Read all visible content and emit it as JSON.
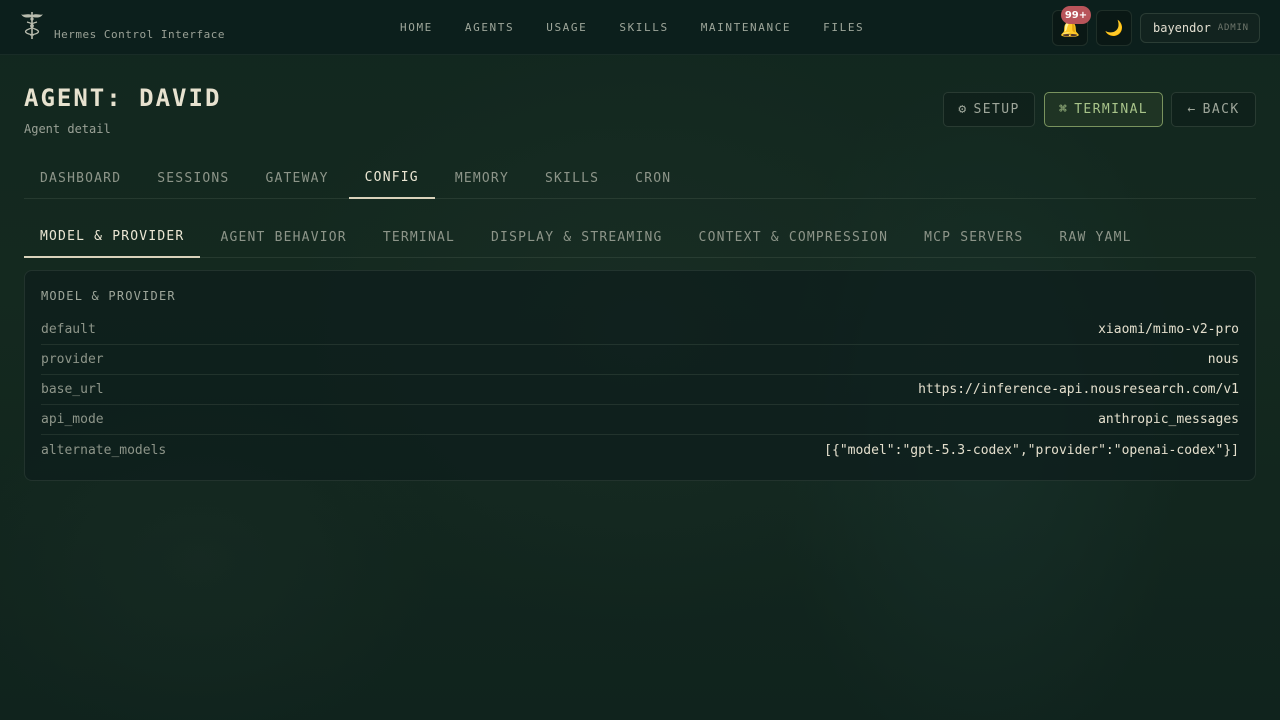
{
  "app": {
    "subtitle": "Hermes Control Interface"
  },
  "nav": [
    "HOME",
    "AGENTS",
    "USAGE",
    "SKILLS",
    "MAINTENANCE",
    "FILES"
  ],
  "header": {
    "notifications_badge": "99+",
    "notification_icon": "bell-icon",
    "theme_icon": "moon-icon",
    "user_name": "bayendor",
    "user_role": "ADMIN"
  },
  "page": {
    "title": "AGENT: DAVID",
    "subtitle": "Agent detail"
  },
  "actions": {
    "setup": {
      "icon": "⚙",
      "label": "SETUP"
    },
    "terminal": {
      "icon": "⌘",
      "label": "TERMINAL"
    },
    "back": {
      "icon": "←",
      "label": "BACK"
    }
  },
  "tabs": {
    "labels": [
      "DASHBOARD",
      "SESSIONS",
      "GATEWAY",
      "CONFIG",
      "MEMORY",
      "SKILLS",
      "CRON"
    ],
    "active": "CONFIG"
  },
  "subtabs": {
    "labels": [
      "MODEL & PROVIDER",
      "AGENT BEHAVIOR",
      "TERMINAL",
      "DISPLAY & STREAMING",
      "CONTEXT & COMPRESSION",
      "MCP SERVERS",
      "RAW YAML"
    ],
    "active": "MODEL & PROVIDER"
  },
  "panel": {
    "title": "MODEL & PROVIDER",
    "rows": [
      {
        "key": "default",
        "value": "xiaomi/mimo-v2-pro"
      },
      {
        "key": "provider",
        "value": "nous"
      },
      {
        "key": "base_url",
        "value": "https://inference-api.nousresearch.com/v1"
      },
      {
        "key": "api_mode",
        "value": "anthropic_messages"
      },
      {
        "key": "alternate_models",
        "value": "[{\"model\":\"gpt-5.3-codex\",\"provider\":\"openai-codex\"}]"
      }
    ]
  },
  "colors": {
    "accent_terminal": "#a8c48a",
    "badge": "#b8545a",
    "active_tab": "#d9d2bb"
  }
}
